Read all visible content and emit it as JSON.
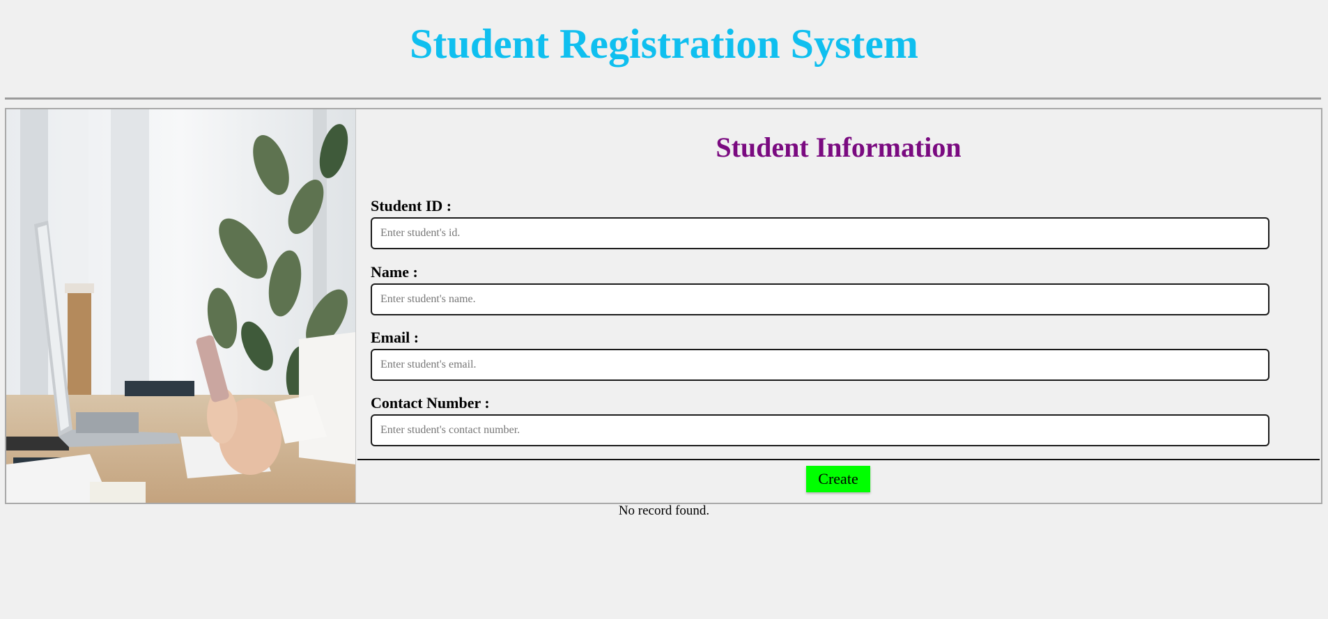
{
  "header": {
    "title": "Student Registration System"
  },
  "form": {
    "title": "Student Information",
    "fields": [
      {
        "label": "Student ID :",
        "placeholder": "Enter student's id.",
        "value": ""
      },
      {
        "label": "Name :",
        "placeholder": "Enter student's name.",
        "value": ""
      },
      {
        "label": "Email :",
        "placeholder": "Enter student's email.",
        "value": ""
      },
      {
        "label": "Contact Number :",
        "placeholder": "Enter student's contact number.",
        "value": ""
      }
    ],
    "submit_label": "Create"
  },
  "records": {
    "empty_message": "No record found."
  },
  "colors": {
    "title": "#0fbfef",
    "section_title": "#7a0a80",
    "button": "#00ff00",
    "background": "#f0f0f0"
  }
}
